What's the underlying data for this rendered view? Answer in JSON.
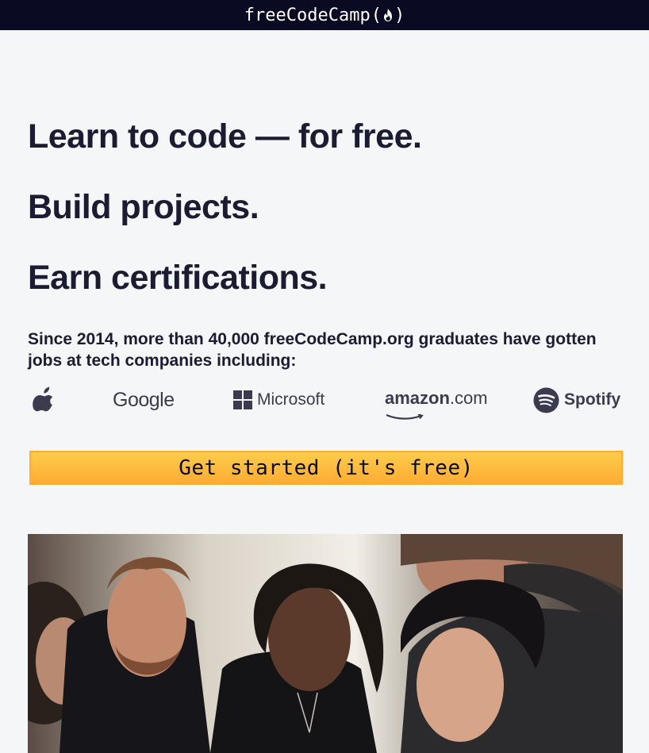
{
  "header": {
    "brand": "freeCodeCamp",
    "brand_open": "(",
    "brand_close": ")"
  },
  "hero": {
    "line1": "Learn to code — for free.",
    "line2": "Build projects.",
    "line3": "Earn certifications.",
    "subtitle": "Since 2014, more than 40,000 freeCodeCamp.org graduates have gotten jobs at tech companies including:"
  },
  "companies": {
    "google": "Google",
    "microsoft": "Microsoft",
    "amazon": "amazon",
    "amazon_suffix": ".com",
    "spotify": "Spotify"
  },
  "cta": {
    "label": "Get started (it's free)"
  },
  "colors": {
    "header_bg": "#0a0a23",
    "page_bg": "#f5f6f7",
    "text": "#1b1b32",
    "cta_gradient_top": "#fecc4c",
    "cta_gradient_bottom": "#ffac33"
  },
  "icons": {
    "brand": "fire-icon",
    "apple": "apple-logo-icon",
    "microsoft": "windows-logo-icon",
    "amazon": "amazon-smile-icon",
    "spotify": "spotify-logo-icon"
  }
}
